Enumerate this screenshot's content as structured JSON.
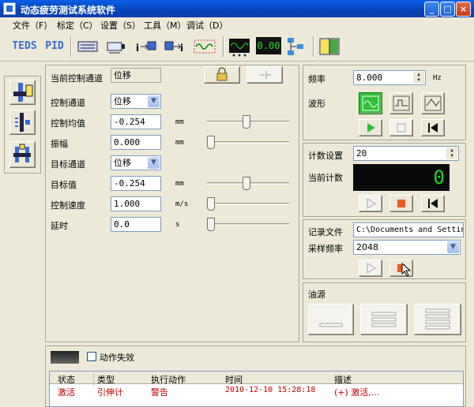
{
  "window": {
    "title": "动态疲劳测试系统软件",
    "min": "_",
    "max": "□",
    "close": "×"
  },
  "menu": [
    {
      "label": "文件（F）"
    },
    {
      "label": "标定（C）"
    },
    {
      "label": "设置（S）"
    },
    {
      "label": "工具（M）"
    },
    {
      "label": "调试（D）"
    }
  ],
  "toolbar": {
    "teds": "TEDS",
    "pid": "PID",
    "digital": "0.00"
  },
  "left": {
    "current_channel_label": "当前控制通道",
    "current_channel_value": "位移",
    "rows": [
      {
        "label": "控制通道",
        "value": "位移",
        "kind": "combo",
        "unit": ""
      },
      {
        "label": "控制均值",
        "value": "-0.254",
        "kind": "input",
        "unit": "mm",
        "level": 0.48
      },
      {
        "label": "振幅",
        "value": "0.000",
        "kind": "input",
        "unit": "mm",
        "level": 0.0
      },
      {
        "label": "目标通道",
        "value": "位移",
        "kind": "combo",
        "unit": ""
      },
      {
        "label": "目标值",
        "value": "-0.254",
        "kind": "input",
        "unit": "mm",
        "level": 0.48
      },
      {
        "label": "控制速度",
        "value": "1.000",
        "kind": "input",
        "unit": "m/s",
        "level": 0.0
      },
      {
        "label": "延时",
        "value": "0.0",
        "kind": "input",
        "unit": "s",
        "level": 0.0
      }
    ]
  },
  "wave": {
    "freq_label": "频率",
    "freq_value": "8.000",
    "freq_unit": "Hz",
    "wave_label": "波形"
  },
  "count": {
    "set_label": "计数设置",
    "set_value": "20",
    "current_label": "当前计数",
    "current_value": "0"
  },
  "record": {
    "file_label": "记录文件",
    "file_value": "C:\\Documents and Settin",
    "rate_label": "采样频率",
    "rate_value": "2048"
  },
  "oil": {
    "label": "油源"
  },
  "bottom": {
    "fail_label": "动作失效",
    "columns": [
      "状态",
      "类型",
      "执行动作",
      "时间",
      "描述"
    ],
    "rows": [
      {
        "status": "激活",
        "type": "引伸计",
        "action": "警告",
        "time": "2010-12-10 15:28:18",
        "desc": "(+) 激活,..."
      }
    ]
  },
  "colors": {
    "title": "#0A5FE8",
    "alert": "#C00000",
    "digit": "#22D622",
    "record_red": "#F05A1E"
  }
}
